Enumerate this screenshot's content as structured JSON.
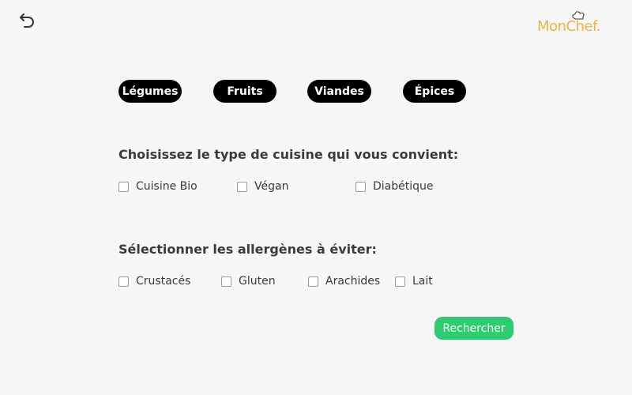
{
  "header": {
    "back_icon": "undo-arrow-icon",
    "logo_text": "MonChef."
  },
  "categories": [
    "Légumes",
    "Fruits",
    "Viandes",
    "Épices"
  ],
  "cuisine": {
    "title": "Choisissez le type de cuisine qui vous convient:",
    "options": [
      "Cuisine Bio",
      "Végan",
      "Diabétique"
    ]
  },
  "allergens": {
    "title": "Sélectionner les allergènes à éviter:",
    "options": [
      "Crustacés",
      "Gluten",
      "Arachides",
      "Lait"
    ]
  },
  "search_label": "Rechercher",
  "colors": {
    "accent": "#2ecc71",
    "chip": "#000000",
    "logo": "#e9b54a",
    "background": "#f7f7f7"
  }
}
